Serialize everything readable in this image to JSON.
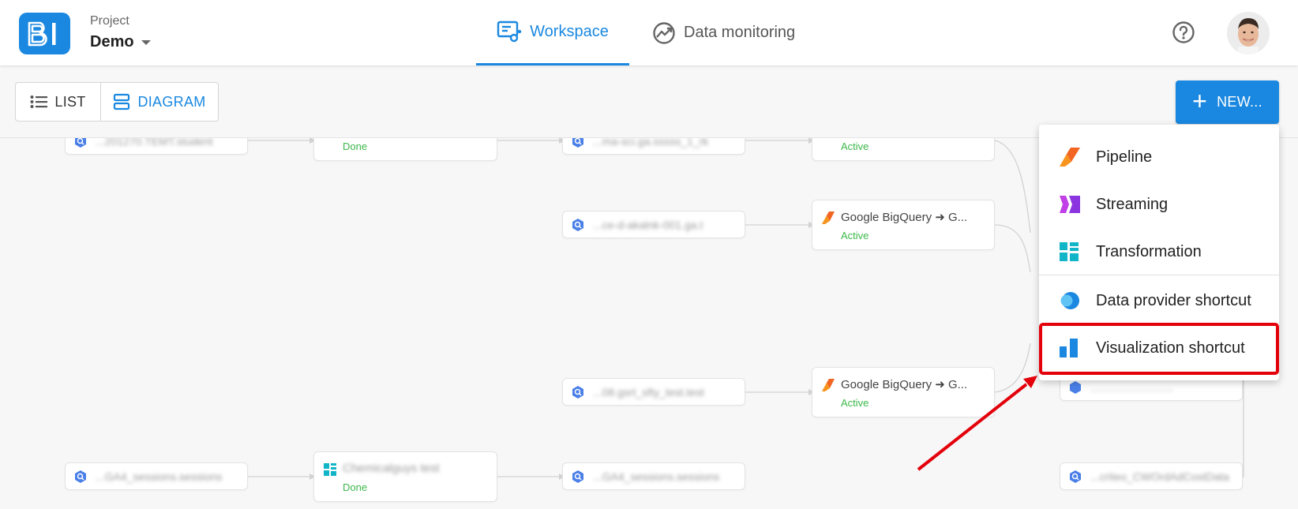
{
  "header": {
    "logo_text": "BI",
    "project_label": "Project",
    "project_name": "Demo",
    "tabs": [
      {
        "label": "Workspace",
        "active": true,
        "icon": "workspace-icon"
      },
      {
        "label": "Data monitoring",
        "active": false,
        "icon": "monitoring-icon"
      }
    ],
    "help_icon": "help-icon",
    "avatar": "user-avatar"
  },
  "toolbar": {
    "list_label": "LIST",
    "diagram_label": "DIAGRAM",
    "new_label": "NEW..."
  },
  "new_menu": {
    "items": [
      {
        "label": "Pipeline",
        "icon": "pipeline-icon"
      },
      {
        "label": "Streaming",
        "icon": "streaming-icon"
      },
      {
        "label": "Transformation",
        "icon": "transformation-icon"
      },
      {
        "label": "Data provider shortcut",
        "icon": "data-provider-icon"
      },
      {
        "label": "Visualization shortcut",
        "icon": "visualization-icon",
        "highlighted": true
      }
    ]
  },
  "diagram": {
    "sources": [
      {
        "label": "...201270.TEMT.student"
      },
      {
        "label": "...ma-sci.ga.sssss_1_rk"
      },
      {
        "label": "...ce-d-akalnk-001.ga.t"
      },
      {
        "label": "...08.gsrt_sfty_test.test"
      },
      {
        "label": "...GA4_sessions.sessions"
      },
      {
        "label": "...GA4_sessions.sessions"
      },
      {
        "label": "...........................",
        "hidden_under_menu": true
      },
      {
        "label": "...criteo_CWOrdAdCostData"
      }
    ],
    "jobs": [
      {
        "title": "",
        "status": "Done",
        "icon": "transformation-icon"
      },
      {
        "title": "",
        "status": "Active",
        "icon": "pipeline-icon"
      },
      {
        "title": "Google BigQuery ➜ G...",
        "status": "Active",
        "icon": "pipeline-icon"
      },
      {
        "title": "Google BigQuery ➜ G...",
        "status": "Active",
        "icon": "pipeline-icon"
      },
      {
        "title": "Chemicalguys test",
        "status": "Done",
        "icon": "transformation-icon"
      }
    ]
  },
  "colors": {
    "primary": "#1a88e0",
    "status_green": "#3cb84a",
    "highlight_red": "#e3000b"
  }
}
